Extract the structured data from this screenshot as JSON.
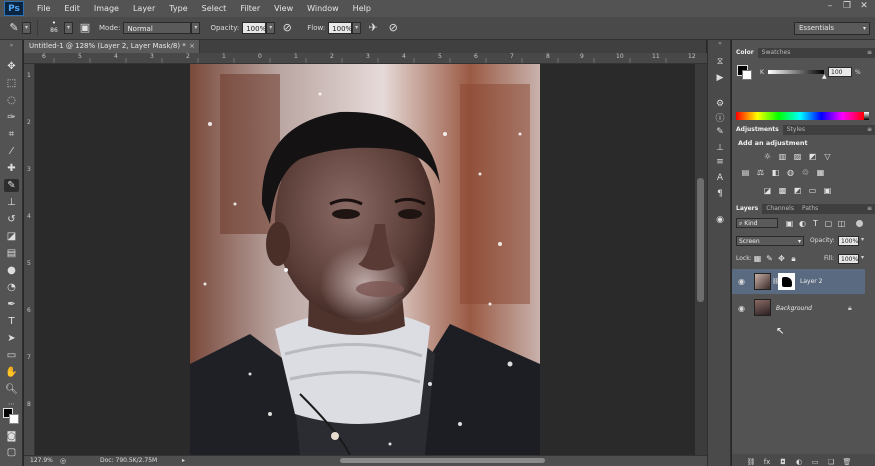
{
  "app": {
    "logo": "Ps",
    "menu": [
      "File",
      "Edit",
      "Image",
      "Layer",
      "Type",
      "Select",
      "Filter",
      "View",
      "Window",
      "Help"
    ]
  },
  "window_controls": {
    "minimize": "–",
    "restore": "❐",
    "close": "✕"
  },
  "options_bar": {
    "brush_size": "86",
    "mode_label": "Mode:",
    "mode_value": "Normal",
    "opacity_label": "Opacity:",
    "opacity_value": "100%",
    "flow_label": "Flow:",
    "flow_value": "100%",
    "workspace": "Essentials"
  },
  "document": {
    "tab_title": "Untitled-1 @ 128% (Layer 2, Layer Mask/8) *",
    "close": "×"
  },
  "rulers": {
    "top": [
      "6",
      "5",
      "4",
      "3",
      "2",
      "1",
      "0",
      "1",
      "2",
      "3",
      "4",
      "5",
      "6",
      "7",
      "8",
      "9",
      "10",
      "11",
      "12"
    ],
    "left": [
      "1",
      "2",
      "3",
      "4",
      "5",
      "6",
      "7",
      "8"
    ]
  },
  "status": {
    "zoom": "127.9%",
    "doc_size": "Doc: 790.5K/2.75M"
  },
  "color_panel": {
    "tabs": [
      "Color",
      "Swatches"
    ],
    "channel": "K",
    "value": "100",
    "unit": "%"
  },
  "adjustments_panel": {
    "tabs": [
      "Adjustments",
      "Styles"
    ],
    "heading": "Add an adjustment"
  },
  "layers_panel": {
    "tabs": [
      "Layers",
      "Channels",
      "Paths"
    ],
    "filter_kind": "Kind",
    "blend_mode": "Screen",
    "opacity_label": "Opacity:",
    "opacity_value": "100%",
    "lock_label": "Lock:",
    "fill_label": "Fill:",
    "fill_value": "100%",
    "layers": [
      {
        "name": "Layer 2",
        "selected": true
      },
      {
        "name": "Background",
        "selected": false
      }
    ]
  },
  "colors": {
    "menubar": "#535353",
    "panel": "#535353",
    "selection": "#5a6a80",
    "canvas": "#2a2a2a"
  }
}
